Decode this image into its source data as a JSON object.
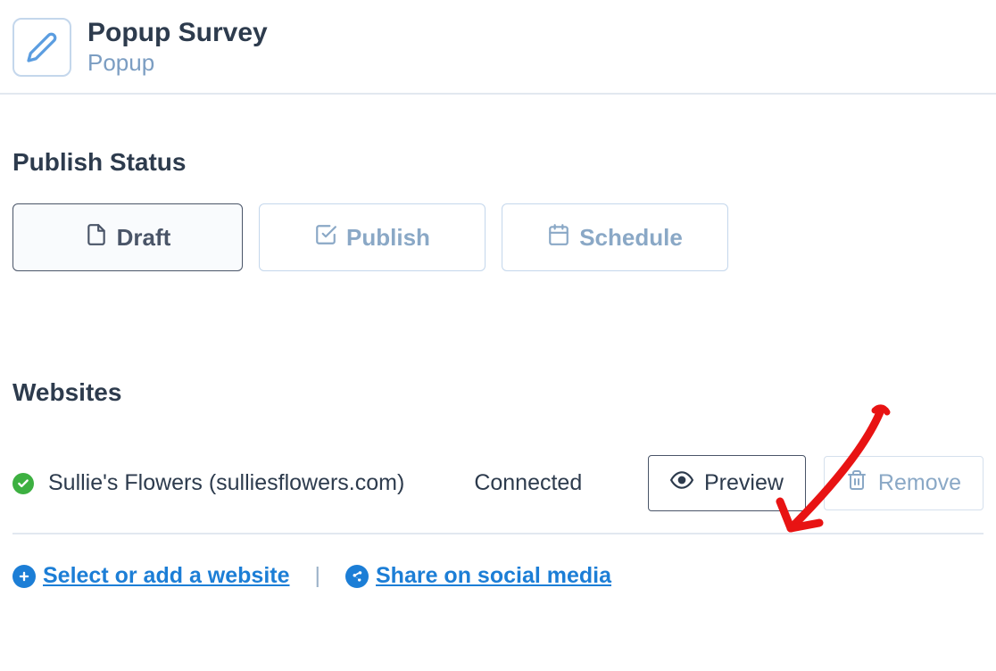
{
  "header": {
    "title": "Popup Survey",
    "subtitle": "Popup"
  },
  "sections": {
    "publish_status_title": "Publish Status",
    "websites_title": "Websites"
  },
  "status": {
    "draft_label": "Draft",
    "publish_label": "Publish",
    "schedule_label": "Schedule"
  },
  "website": {
    "name": "Sullie's Flowers (sulliesflowers.com)",
    "status": "Connected",
    "preview_label": "Preview",
    "remove_label": "Remove"
  },
  "actions": {
    "add_website_label": "Select or add a website",
    "share_label": "Share on social media",
    "separator": "|"
  }
}
